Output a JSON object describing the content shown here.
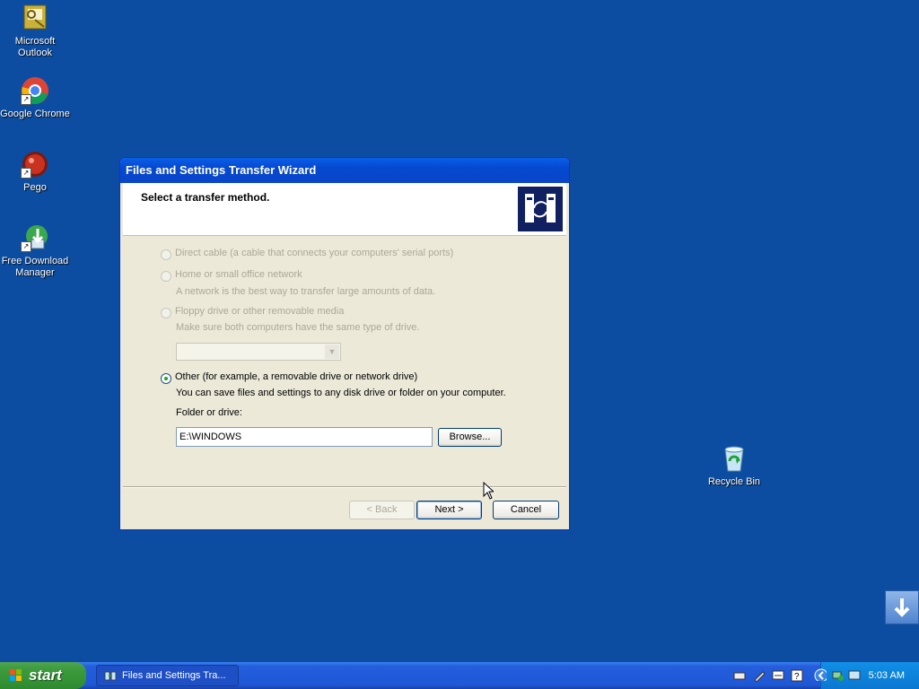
{
  "desktop": {
    "icons": [
      {
        "label": "Microsoft Outlook",
        "icon": "outlook-icon"
      },
      {
        "label": "Google Chrome",
        "icon": "chrome-icon"
      },
      {
        "label": "Pego",
        "icon": "pego-icon"
      },
      {
        "label": "Free Download Manager",
        "icon": "fdm-icon"
      },
      {
        "label": "Recycle Bin",
        "icon": "recycle-bin-icon"
      }
    ]
  },
  "wizard": {
    "title": "Files and Settings Transfer Wizard",
    "heading": "Select a transfer method.",
    "options": {
      "direct_cable": "Direct cable (a cable that connects your computers' serial ports)",
      "home_network": "Home or small office network",
      "home_network_desc": "A network is the best way to transfer large amounts of data.",
      "floppy": "Floppy drive or other removable media",
      "floppy_desc": "Make sure both computers have the same type of drive.",
      "other": "Other (for example, a removable drive or network drive)",
      "other_desc": "You can save files and settings to any disk drive or folder on your computer."
    },
    "folder_label": "Folder or drive:",
    "folder_value": "E:\\WINDOWS",
    "browse_label": "Browse...",
    "back_label": "< Back",
    "next_label": "Next >",
    "cancel_label": "Cancel"
  },
  "taskbar": {
    "start_label": "start",
    "task_label": "Files and Settings Tra...",
    "clock": "5:03 AM"
  }
}
